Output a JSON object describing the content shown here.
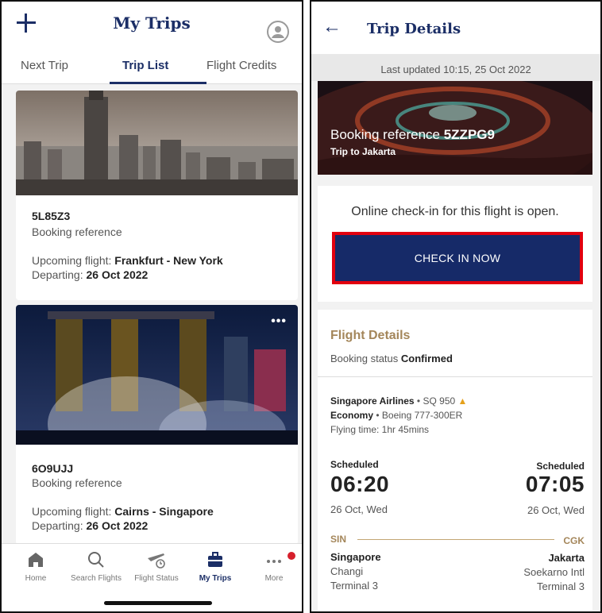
{
  "left": {
    "header": {
      "title": "My Trips"
    },
    "tabs": [
      "Next Trip",
      "Trip List",
      "Flight Credits"
    ],
    "trips": [
      {
        "reference": "5L85Z3",
        "reference_label": "Booking reference",
        "upcoming_label": "Upcoming flight:",
        "route": "Frankfurt - New York",
        "departing_label": "Departing:",
        "departing": "26 Oct 2022"
      },
      {
        "reference": "6O9UJJ",
        "reference_label": "Booking reference",
        "upcoming_label": "Upcoming flight:",
        "route": "Cairns - Singapore",
        "departing_label": "Departing:",
        "departing": "26 Oct 2022"
      }
    ],
    "menu_dots": "•••",
    "nav": [
      {
        "label": "Home",
        "icon": "home-icon"
      },
      {
        "label": "Search Flights",
        "icon": "search-icon"
      },
      {
        "label": "Flight Status",
        "icon": "flight-status-icon"
      },
      {
        "label": "My Trips",
        "icon": "suitcase-icon"
      },
      {
        "label": "More",
        "icon": "more-icon"
      }
    ],
    "colors": {
      "brand": "#1b2e66",
      "badge": "#d61f2c"
    }
  },
  "right": {
    "header": {
      "title": "Trip Details"
    },
    "updated": "Last updated 10:15, 25 Oct 2022",
    "hero": {
      "ref_prefix": "Booking reference",
      "ref_code": "5ZZPG9",
      "trip": "Trip to Jakarta"
    },
    "checkin": {
      "message": "Online check-in for this flight is open.",
      "button": "CHECK IN NOW"
    },
    "flight": {
      "section_title": "Flight Details",
      "status_label": "Booking status",
      "status": "Confirmed",
      "airline": "Singapore Airlines",
      "flight_no": "SQ 950",
      "cabin": "Economy",
      "aircraft": "Boeing 777-300ER",
      "flying_time": "Flying time: 1hr 45mins",
      "depart": {
        "label": "Scheduled",
        "time": "06:20",
        "date": "26 Oct, Wed",
        "code": "SIN",
        "city": "Singapore",
        "airport": "Changi",
        "terminal": "Terminal 3"
      },
      "arrive": {
        "label": "Scheduled",
        "time": "07:05",
        "date": "26 Oct, Wed",
        "code": "CGK",
        "city": "Jakarta",
        "airport": "Soekarno Intl",
        "terminal": "Terminal 3"
      }
    },
    "colors": {
      "brand": "#162a68",
      "highlight": "#e2000f",
      "gold": "#a4865a"
    }
  }
}
